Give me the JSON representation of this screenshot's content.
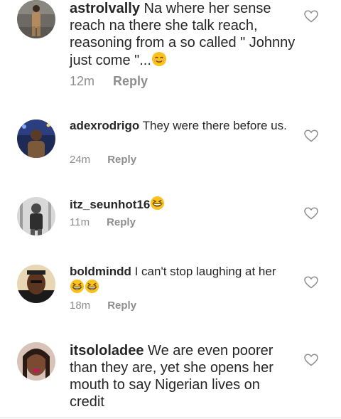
{
  "colors": {
    "text": "#262626",
    "meta": "#8e8e8e",
    "divider": "#dbdbdb"
  },
  "comments": [
    {
      "username": "astrolvally",
      "text": "Na where her sense reach na there she talk reach, reasoning from a so called \" Johnny just come \"...",
      "emoji": "smiling-face-emoji",
      "time": "12m",
      "reply_label": "Reply",
      "avatar": "avatar-man-standing",
      "like_icon": "heart-outline-icon"
    },
    {
      "username": "adexrodrigo",
      "text": "They were there before us.",
      "time": "24m",
      "reply_label": "Reply",
      "avatar": "avatar-man-night",
      "like_icon": "heart-outline-icon"
    },
    {
      "username": "itz_seunhot16",
      "text": "",
      "emoji": "grinning-squinting-face-emoji",
      "time": "11m",
      "reply_label": "Reply",
      "avatar": "avatar-grayscale",
      "like_icon": "heart-outline-icon"
    },
    {
      "username": "boldmindd",
      "text": "I can't stop laughing at her",
      "emoji": "grinning-squinting-face-emoji x2",
      "time": "18m",
      "reply_label": "Reply",
      "avatar": "avatar-man-portrait",
      "like_icon": "heart-outline-icon"
    },
    {
      "username": "itsololadee",
      "text": "We are even poorer than they are, yet she opens her mouth to say Nigerian lives on credit",
      "avatar": "avatar-woman-selfie",
      "like_icon": "heart-outline-icon"
    }
  ]
}
